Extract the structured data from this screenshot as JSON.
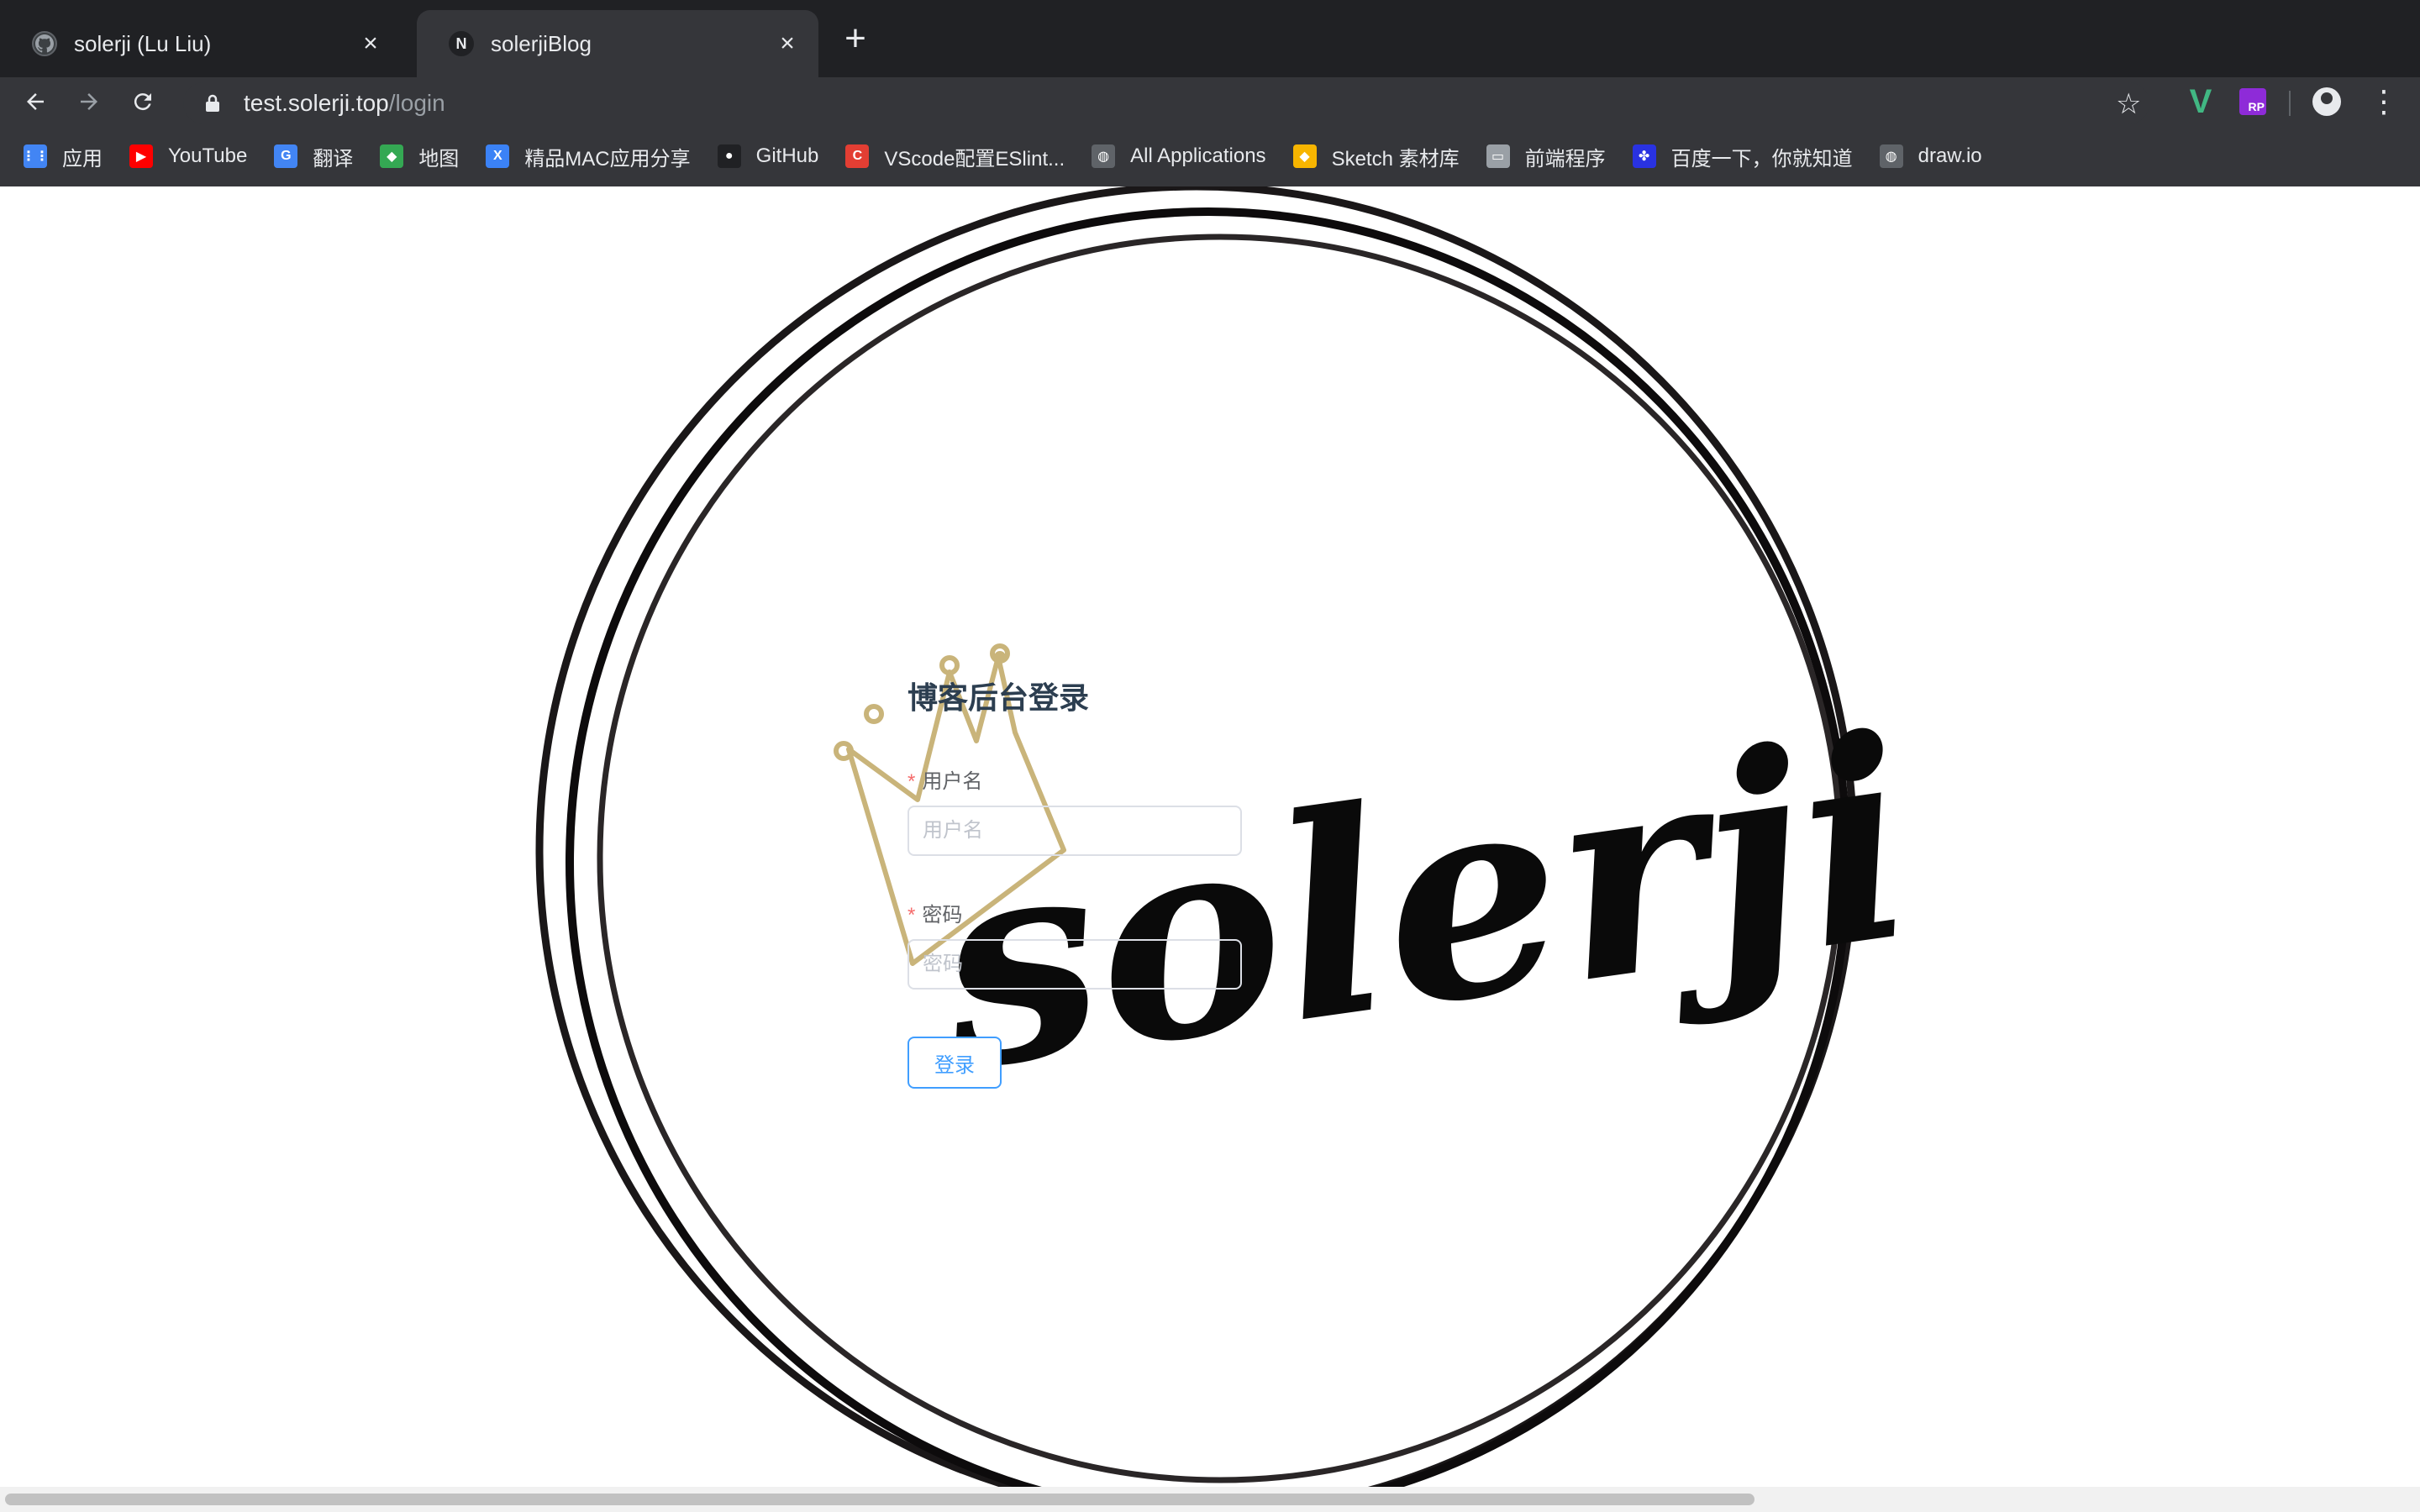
{
  "browser": {
    "tabs": [
      {
        "title": "solerji (Lu Liu)",
        "favicon": "github-icon",
        "active": false
      },
      {
        "title": "solerjiBlog",
        "favicon": "N",
        "active": true
      }
    ],
    "url": {
      "host": "test.solerji.top",
      "path": "/login"
    },
    "bookmarks": [
      {
        "label": "应用",
        "icon": "apps-grid-icon",
        "color": "#4285f4"
      },
      {
        "label": "YouTube",
        "icon": "youtube-icon",
        "color": "#ff0000"
      },
      {
        "label": "翻译",
        "icon": "google-translate-icon",
        "color": "#4285f4"
      },
      {
        "label": "地图",
        "icon": "google-maps-icon",
        "color": "#34a853"
      },
      {
        "label": "精品MAC应用分享",
        "icon": "xclient-icon",
        "color": "#3b82f6"
      },
      {
        "label": "GitHub",
        "icon": "github-icon",
        "color": "#202124"
      },
      {
        "label": "VScode配置ESlint...",
        "icon": "csdn-icon",
        "color": "#e33e33"
      },
      {
        "label": "All Applications",
        "icon": "globe-icon",
        "color": "#5f6368"
      },
      {
        "label": "Sketch 素材库",
        "icon": "sketch-diamond-icon",
        "color": "#f7b500"
      },
      {
        "label": "前端程序",
        "icon": "folder-icon",
        "color": "#9aa0a6"
      },
      {
        "label": "百度一下，你就知道",
        "icon": "baidu-paw-icon",
        "color": "#2932e1"
      },
      {
        "label": "draw.io",
        "icon": "globe-icon",
        "color": "#5f6368"
      }
    ]
  },
  "page": {
    "logo_text": "solerji",
    "heading": "博客后台登录",
    "username": {
      "label": "用户名",
      "placeholder": "用户名",
      "required_mark": "*"
    },
    "password": {
      "label": "密码",
      "placeholder": "密码",
      "required_mark": "*"
    },
    "submit_label": "登录"
  },
  "colors": {
    "accent": "#409eff",
    "required": "#f56c6c",
    "heading": "#2c3e50",
    "crown": "#c9b47a"
  }
}
